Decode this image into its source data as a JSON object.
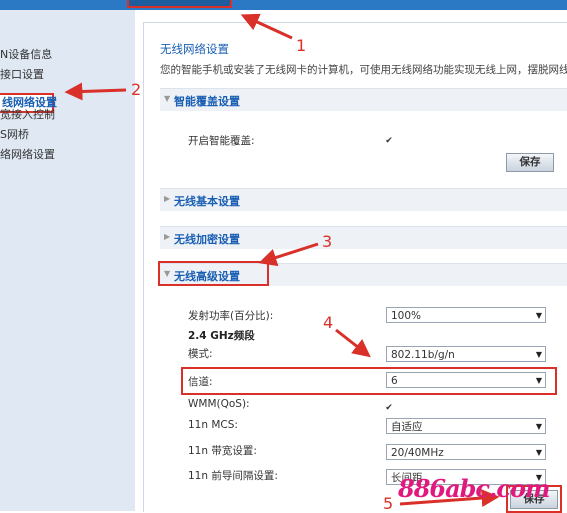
{
  "sidebar": {
    "items": [
      {
        "label": "N设备信息"
      },
      {
        "label": "接口设置"
      },
      {
        "label": "线网络设置"
      },
      {
        "label": "宽接入控制"
      },
      {
        "label": "S网桥"
      },
      {
        "label": "络网络设置"
      }
    ]
  },
  "main": {
    "title": "无线网络设置",
    "description": "您的智能手机或安装了无线网卡的计算机，可使用无线网络功能实现无线上网，摆脱网线"
  },
  "smart_coverage": {
    "header": "智能覆盖设置",
    "enable_label": "开启智能覆盖:",
    "enabled": true,
    "save_label": "保存"
  },
  "sections": {
    "basic": "无线基本设置",
    "security": "无线加密设置",
    "advanced": "无线高级设置"
  },
  "advanced": {
    "tx_power_label": "发射功率(百分比):",
    "tx_power_value": "100%",
    "band_label": "2.4 GHz频段",
    "mode_label": "模式:",
    "mode_value": "802.11b/g/n",
    "channel_label": "信道:",
    "channel_value": "6",
    "wmm_label": "WMM(QoS):",
    "wmm_enabled": true,
    "mcs_label": "11n MCS:",
    "mcs_value": "自适应",
    "bandwidth_label": "11n 带宽设置:",
    "bandwidth_value": "20/40MHz",
    "guard_label": "11n 前导间隔设置:",
    "guard_value": "长间距",
    "save_label": "保存"
  },
  "annotations": {
    "n1": "1",
    "n2": "2",
    "n3": "3",
    "n4": "4",
    "n5": "5",
    "color": "#d9302a"
  },
  "watermark": "886abc.com"
}
